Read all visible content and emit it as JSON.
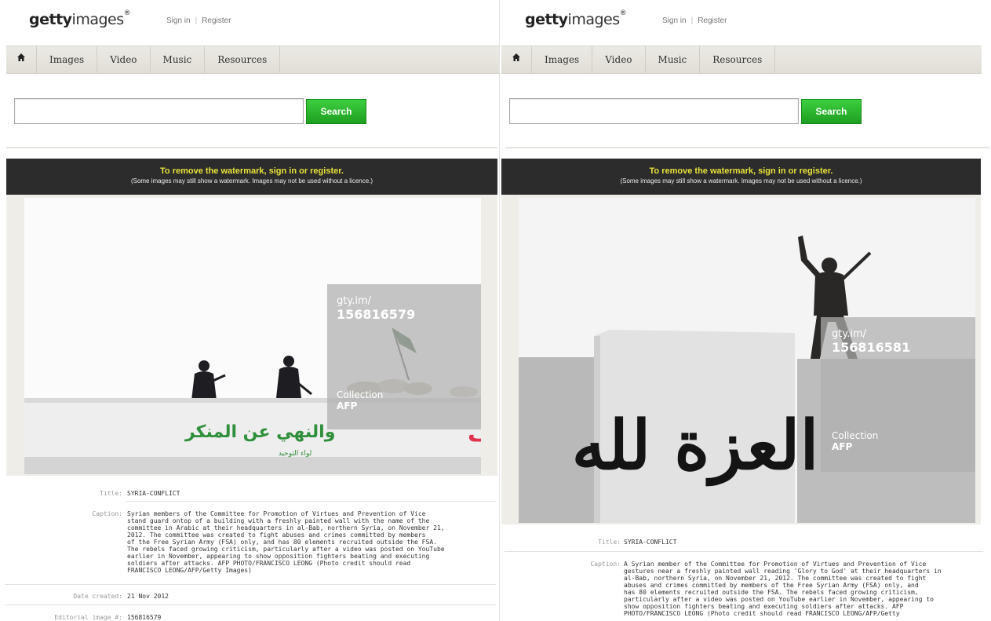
{
  "header": {
    "logo_bold": "getty",
    "logo_light": "images",
    "logo_mark": "®",
    "sign_in": "Sign in",
    "sep": "|",
    "register": "Register"
  },
  "nav": {
    "home_icon": "home-icon",
    "home_glyph": "🏠",
    "items": [
      "Images",
      "Video",
      "Music",
      "Resources"
    ]
  },
  "search": {
    "placeholder": "",
    "button": "Search"
  },
  "banner": {
    "line1": "To remove the watermark, sign in or register.",
    "line2": "(Some images may still show a watermark. Images may not be used without a licence.)"
  },
  "left": {
    "watermark": {
      "gty": "gty.im/",
      "number": "156816579",
      "collection": "Collection",
      "agency": "AFP"
    },
    "wall_text": "هيئة الامر بالمعروف والنهي عن المنكر",
    "wall_small": "لواء التوحيد",
    "meta": {
      "title_label": "Title:",
      "title": "SYRIA-CONFLICT",
      "caption_label": "Caption:",
      "caption_lines": [
        "Syrian members of the Committee for Promotion of Virtues and Prevention of Vice",
        "stand guard ontop of a building with a freshly painted wall with the name of the",
        "committee in Arabic at their headquarters in al-Bab, northern Syria, on November 21,",
        "2012. The committee was created to fight abuses and crimes committed by members",
        "of the Free Syrian Army (FSA) only, and has 80 elements recruited outside the FSA.",
        "The rebels faced growing criticism, particularly after a video was posted on YouTube",
        "earlier in November, appearing to show opposition fighters beating and executing",
        "soldiers after attacks. AFP PHOTO/FRANCISCO LEONG (Photo credit should read",
        "FRANCISCO LEONG/AFP/Getty Images)"
      ],
      "date_label": "Date created:",
      "date": "21 Nov 2012",
      "editorial_label": "Editorial image #:",
      "editorial": "156816579"
    }
  },
  "right": {
    "watermark": {
      "gty": "gty.im/",
      "number": "156816581",
      "collection": "Collection",
      "agency": "AFP"
    },
    "wall_text": "العزة لله",
    "meta": {
      "title_label": "Title:",
      "title": "SYRIA-CONFLICT",
      "caption_label": "Caption:",
      "caption_lines": [
        "A Syrian member of the Committee for Promotion of Virtues and Prevention of Vice",
        "gestures near a freshly painted wall reading 'Glory to God' at their headquarters in",
        "al-Bab, northern Syria, on November 21, 2012. The committee was created to fight",
        "abuses and crimes committed by members of the Free Syrian Army (FSA) only, and",
        "has 80 elements recruited outside the FSA. The rebels faced growing criticism,",
        "particularly after a video was posted on YouTube earlier in November, appearing to",
        "show opposition fighters beating and executing soldiers after attacks. AFP",
        "PHOTO/FRANCISCO LEONG (Photo credit should read FRANCISCO LEONG/AFP/Getty"
      ]
    }
  },
  "colors": {
    "search_green": "#25b027",
    "banner_bg": "#2c2c2c",
    "banner_text": "#e8e23a",
    "nav_bg": "#e6e4dd"
  }
}
